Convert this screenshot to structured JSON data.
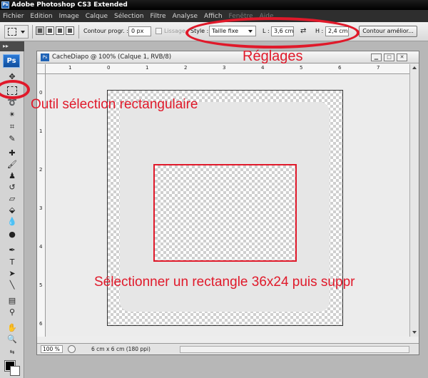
{
  "app": {
    "title": "Adobe Photoshop CS3 Extended",
    "icon_text": "Ps"
  },
  "menu": {
    "items": [
      "Fichier",
      "Edition",
      "Image",
      "Calque",
      "Sélection",
      "Filtre",
      "Analyse",
      "Affich",
      "Fenêtre",
      "Aide"
    ]
  },
  "options": {
    "feather_label": "Contour progr. :",
    "feather_value": "0 px",
    "antialias_label": "Lissage",
    "style_label": "Style :",
    "style_value": "Taille fixe",
    "width_label": "L :",
    "width_value": "3,6 cm",
    "height_label": "H :",
    "height_value": "2,4 cm",
    "refine_button": "Contour amélior..."
  },
  "toolbar": {
    "grip": "▸▸",
    "logo": "Ps"
  },
  "document": {
    "title": "CacheDiapo @ 100% (Calque 1, RVB/8)",
    "zoom": "100 %",
    "doc_info": "6 cm x 6 cm (180 ppi)",
    "ruler_h": [
      "1",
      "0",
      "1",
      "2",
      "3",
      "4",
      "5",
      "6",
      "7"
    ],
    "ruler_v": [
      "0",
      "1",
      "2",
      "3",
      "4",
      "5",
      "6"
    ]
  },
  "annotations": {
    "reglages": "Réglages",
    "outil": "Outil sélection rectangulaire",
    "selection": "Sélectionner un rectangle 36x24 puis suppr"
  },
  "colors": {
    "annotation": "#e0192a",
    "menubar": "#2e2e2e",
    "titlebar": "#000000"
  }
}
